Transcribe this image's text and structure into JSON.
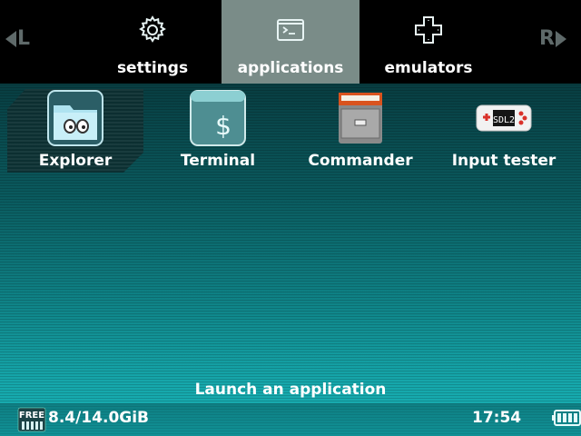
{
  "nav": {
    "left_shoulder": "L",
    "right_shoulder": "R",
    "tabs": [
      {
        "label": "settings",
        "icon": "gear-icon"
      },
      {
        "label": "applications",
        "icon": "terminal-window-icon",
        "selected": true
      },
      {
        "label": "emulators",
        "icon": "dpad-icon"
      }
    ]
  },
  "apps": [
    {
      "label": "Explorer",
      "icon": "explorer-folder-icon",
      "selected": true
    },
    {
      "label": "Terminal",
      "icon": "terminal-dollar-icon"
    },
    {
      "label": "Commander",
      "icon": "file-cabinet-icon"
    },
    {
      "label": "Input tester",
      "icon": "sdl2-gamepad-icon"
    }
  ],
  "hint": "Launch an application",
  "status": {
    "free_label": "FREE",
    "storage": "8.4/14.0GiB",
    "time": "17:54",
    "battery_icon": "battery-icon"
  },
  "colors": {
    "selected_tab": "#7a8c88",
    "accent": "#16a7ab"
  }
}
